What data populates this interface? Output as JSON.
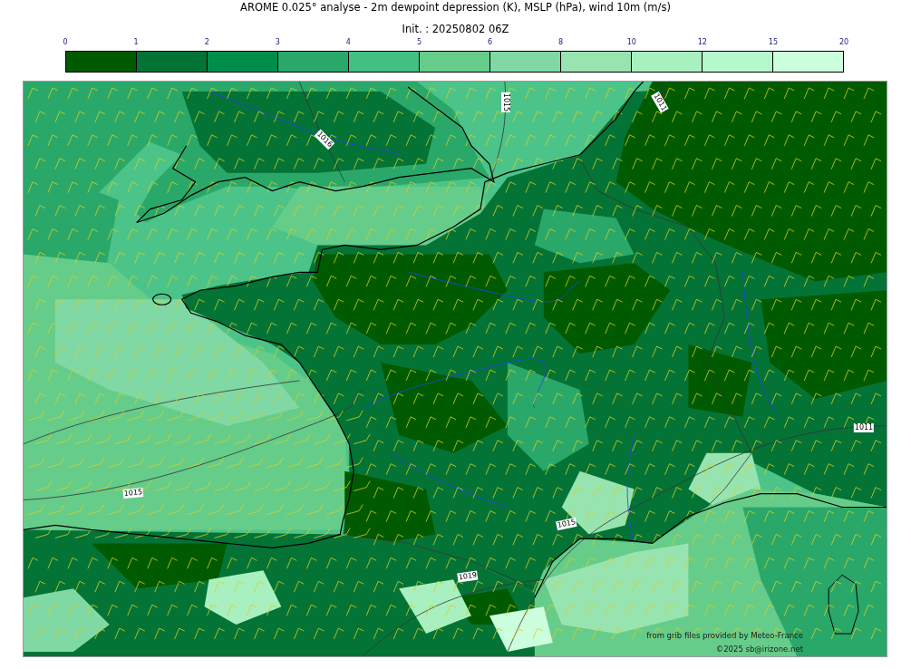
{
  "title": "AROME 0.025° analyse - 2m dewpoint depression (K), MSLP (hPa), wind 10m (m/s)",
  "subtitle": "Init. : 20250802 06Z",
  "colorbar": {
    "ticks": [
      "0",
      "1",
      "2",
      "3",
      "4",
      "5",
      "6",
      "8",
      "10",
      "12",
      "15",
      "20"
    ],
    "bins": [
      {
        "color": "#005a00"
      },
      {
        "color": "#047336"
      },
      {
        "color": "#008c4b"
      },
      {
        "color": "#2aa86a"
      },
      {
        "color": "#42c084"
      },
      {
        "color": "#66cc8a"
      },
      {
        "color": "#80d8a4"
      },
      {
        "color": "#98e4b0"
      },
      {
        "color": "#a8f0c0"
      },
      {
        "color": "#b4f8cc"
      },
      {
        "color": "#ccffdd"
      }
    ]
  },
  "map": {
    "isobar_labels": [
      "1015",
      "1011",
      "1016",
      "1015",
      "1015",
      "1019",
      "1011"
    ],
    "credits": [
      "from grib files provided by Meteo-France",
      "©2025 sb@irizone.net"
    ]
  }
}
